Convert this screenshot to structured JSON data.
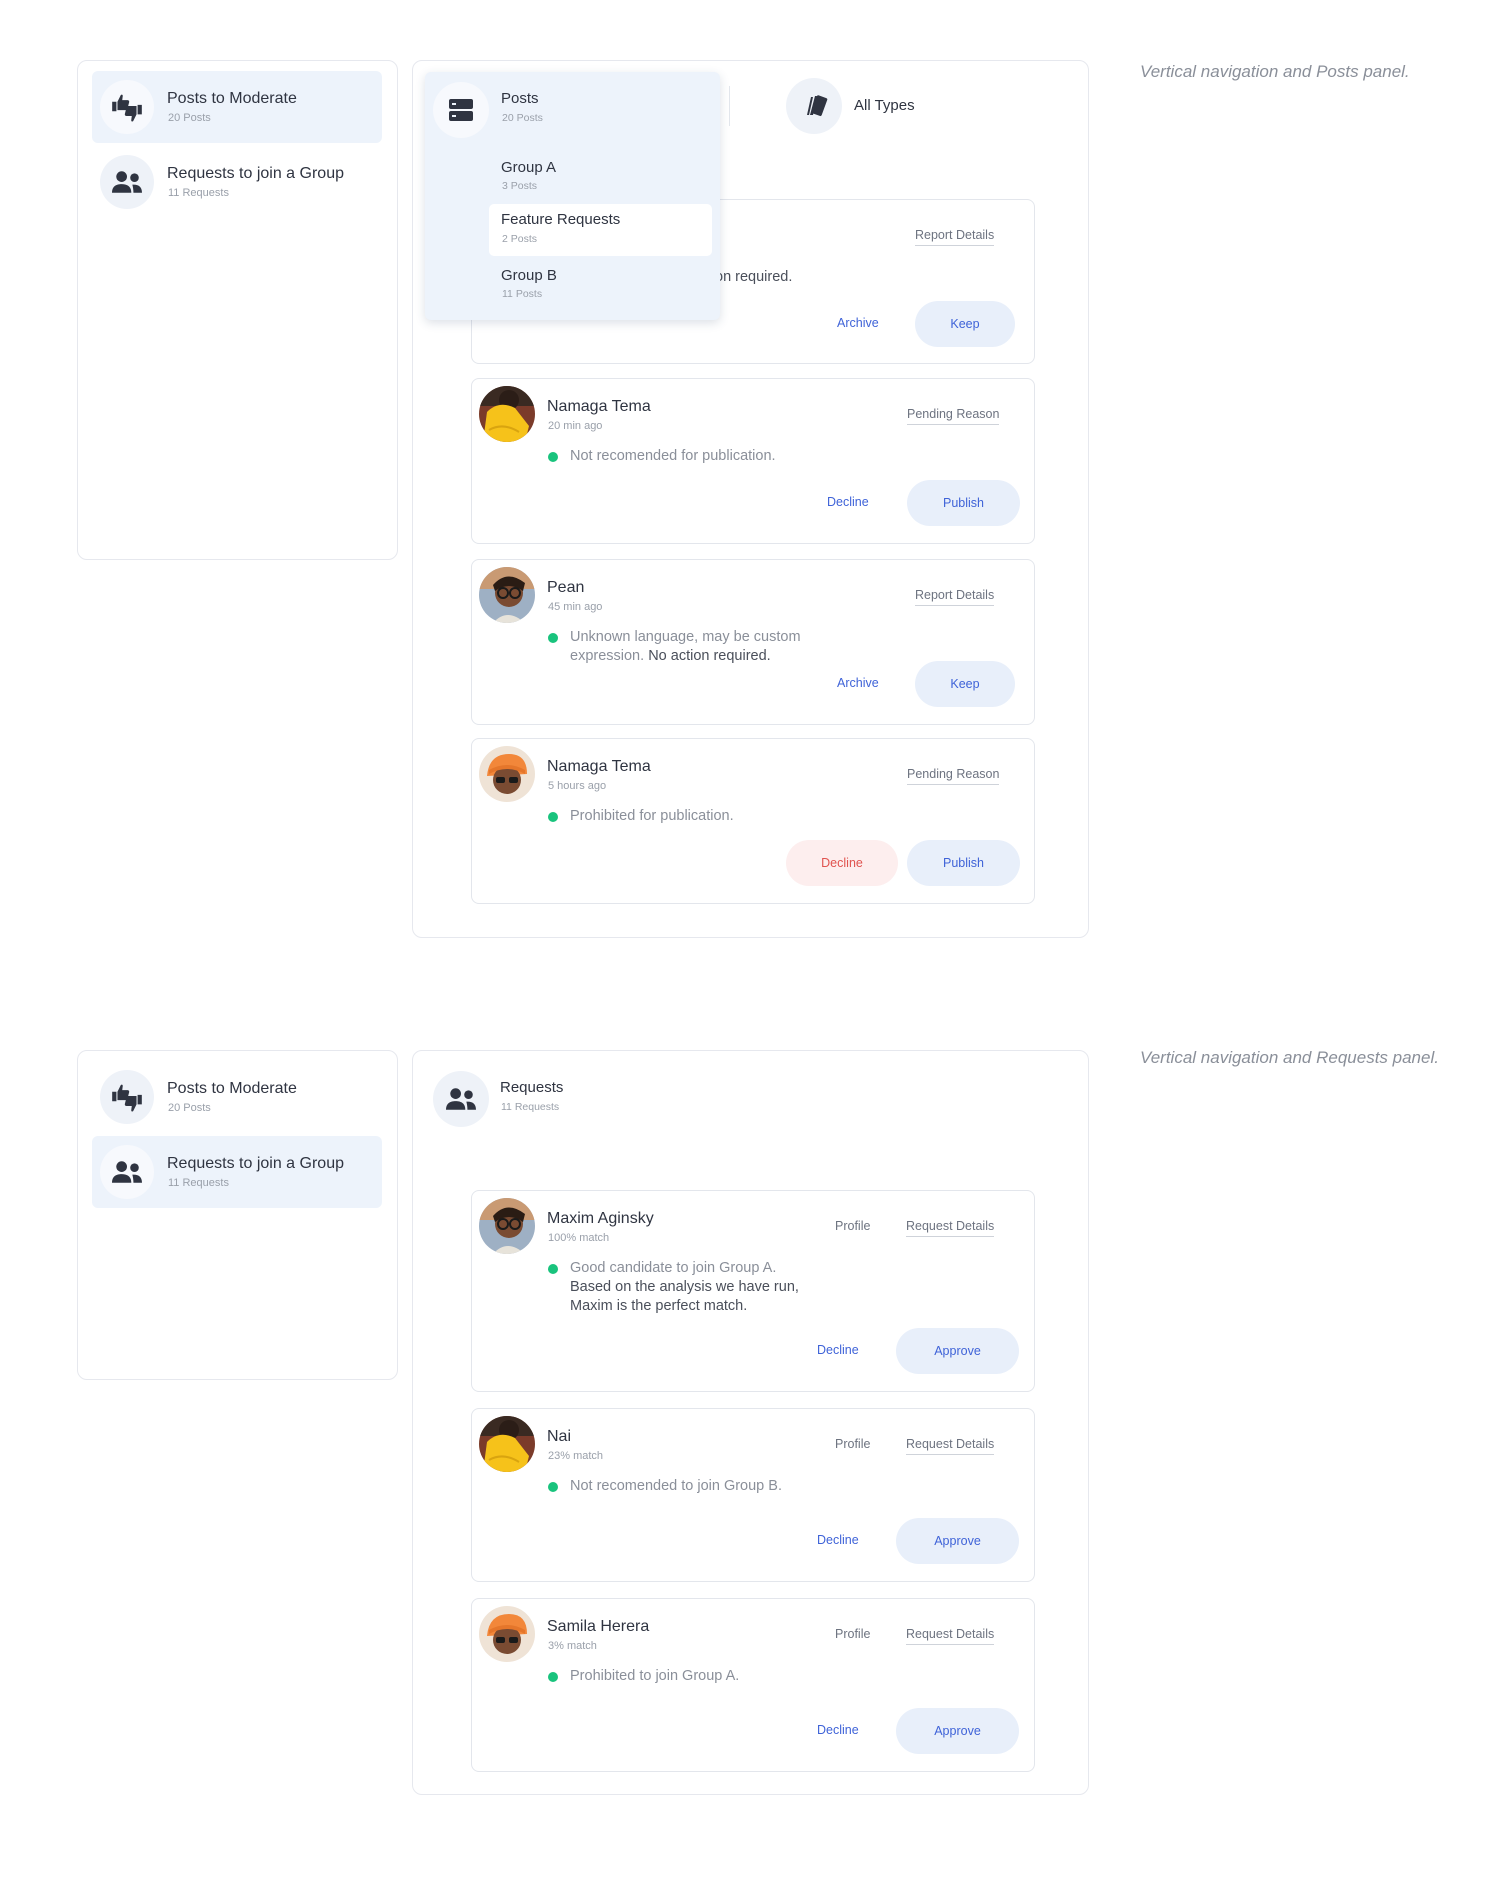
{
  "captions": {
    "top": "Vertical navigation and Posts panel.",
    "bottom": "Vertical navigation and Requests panel."
  },
  "nav": {
    "posts": {
      "title": "Posts to Moderate",
      "sub": "20 Posts",
      "icon": "thumbs-up-down-icon"
    },
    "requests": {
      "title": "Requests to join a Group",
      "sub": "11 Requests",
      "icon": "people-icon"
    }
  },
  "posts_panel": {
    "all_types_label": "All Types",
    "dropdown": {
      "header": {
        "title": "Posts",
        "sub": "20 Posts"
      },
      "items": [
        {
          "title": "Group A",
          "sub": "3 Posts",
          "selected": false
        },
        {
          "title": "Feature Requests",
          "sub": "2 Posts",
          "selected": true
        },
        {
          "title": "Group B",
          "sub": "11 Posts",
          "selected": false
        }
      ]
    },
    "cards": [
      {
        "link": "Report Details",
        "msg_visible": "on required.",
        "secondary": "Archive",
        "primary": "Keep"
      },
      {
        "name": "Namaga Tema",
        "time": "20 min ago",
        "link": "Pending Reason",
        "msg": "Not recomended for publication.",
        "secondary": "Decline",
        "primary": "Publish"
      },
      {
        "name": "Pean",
        "time": "45 min ago",
        "link": "Report Details",
        "msg1": "Unknown language, may be custom",
        "msg2a": "expression. ",
        "msg2b": "No action required.",
        "secondary": "Archive",
        "primary": "Keep"
      },
      {
        "name": "Namaga Tema",
        "time": "5 hours ago",
        "link": "Pending Reason",
        "msg": "Prohibited for publication.",
        "secondary": "Decline",
        "primary": "Publish"
      }
    ]
  },
  "requests_panel": {
    "header": {
      "title": "Requests",
      "sub": "11 Requests"
    },
    "cards": [
      {
        "name": "Maxim Aginsky",
        "match": "100% match",
        "profile": "Profile",
        "details": "Request Details",
        "msg1": "Good candidate to join Group A.",
        "msg2": "Based on the analysis we have run,",
        "msg3": "Maxim is the perfect match.",
        "decline": "Decline",
        "approve": "Approve"
      },
      {
        "name": "Nai",
        "match": "23% match",
        "profile": "Profile",
        "details": "Request Details",
        "msg1": "Not recomended to join Group B.",
        "decline": "Decline",
        "approve": "Approve"
      },
      {
        "name": "Samila Herera",
        "match": "3% match",
        "profile": "Profile",
        "details": "Request Details",
        "msg1": "Prohibited to join Group A.",
        "decline": "Decline",
        "approve": "Approve"
      }
    ]
  },
  "colors": {
    "accent": "#3f63d8",
    "status_green": "#19c37d",
    "danger": "#e0534f",
    "selected_bg": "#edf3fb"
  }
}
